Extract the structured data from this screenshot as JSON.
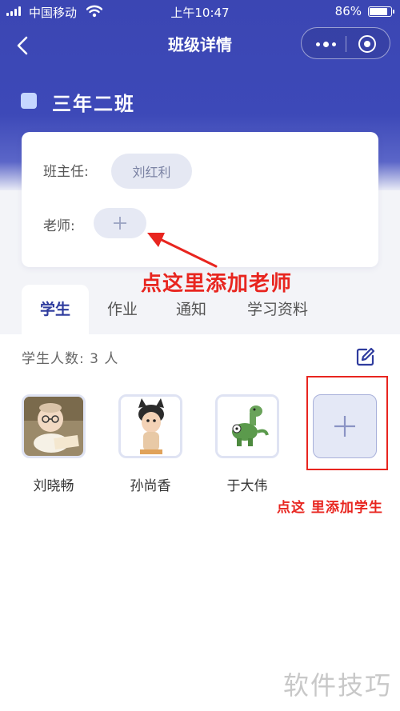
{
  "status_bar": {
    "carrier": "中国移动",
    "time": "上午10:47",
    "battery_pct": "86%",
    "battery_level": 0.86
  },
  "nav": {
    "title": "班级详情"
  },
  "class_info": {
    "name": "三年二班",
    "head_teacher_label": "班主任:",
    "head_teacher_name": "刘红利",
    "teacher_label": "老师:"
  },
  "annotations": {
    "add_teacher": "点这里添加老师",
    "add_student": "点这 里添加学生"
  },
  "tabs": [
    {
      "label": "学生",
      "active": true
    },
    {
      "label": "作业",
      "active": false
    },
    {
      "label": "通知",
      "active": false
    },
    {
      "label": "学习资料",
      "active": false
    }
  ],
  "students_section": {
    "count_text": "学生人数: 3 人",
    "students": [
      {
        "name": "刘晓畅"
      },
      {
        "name": "孙尚香"
      },
      {
        "name": "于大伟"
      }
    ]
  },
  "watermark": "软件技巧",
  "colors": {
    "header": "#3b46b3",
    "accent": "#2f3c9e",
    "annotation_red": "#e8251f"
  }
}
